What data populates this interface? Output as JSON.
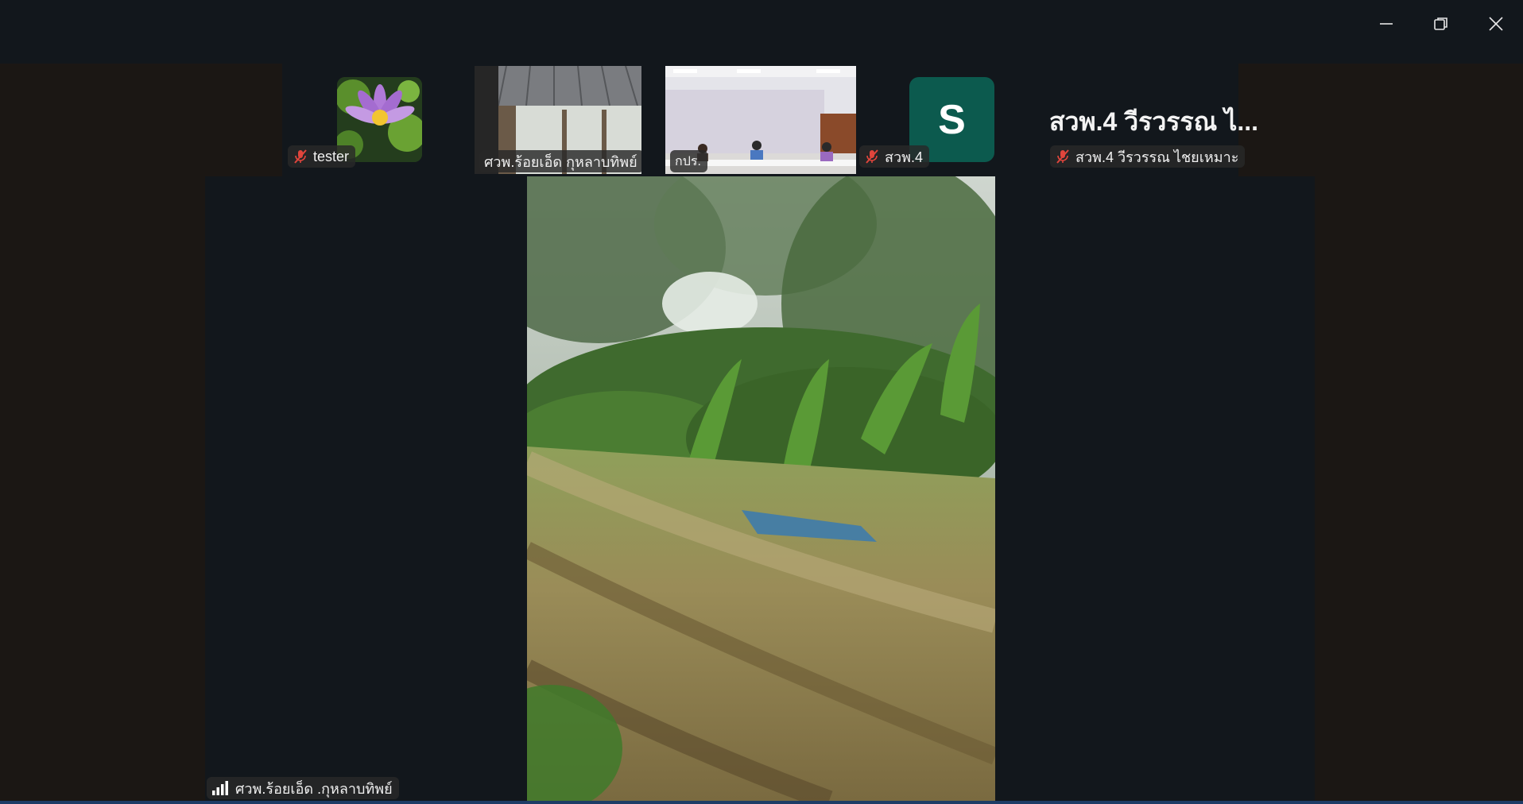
{
  "window": {
    "minimize_icon": "minimize-icon",
    "restore_icon": "restore-icon",
    "close_icon": "close-icon"
  },
  "participants": [
    {
      "name": "tester",
      "muted": true,
      "thumbnail": "lotus-flower-image"
    },
    {
      "name": "ศวพ.ร้อยเอ็ด กุหลาบทิพย์",
      "muted": false,
      "thumbnail": "farm-shed-video"
    },
    {
      "name": "กปร.",
      "muted": false,
      "thumbnail": "meeting-room-video"
    },
    {
      "name": "สวพ.4",
      "muted": true,
      "avatar_letter": "S",
      "avatar_color": "#0c5a4e"
    },
    {
      "name": "สวพ.4 วีรวรรณ ไชยเหมาะ",
      "muted": true,
      "display_title": "สวพ.4 วีรวรรณ ไ..."
    }
  ],
  "active_speaker": {
    "name": "ศวพ.ร้อยเอ็ด .กุหลาบทิพย์",
    "video": "banana-field-video",
    "connection_icon": "signal-bars-icon"
  },
  "colors": {
    "background": "#12171c",
    "muted_icon": "#e0453c",
    "accent_bar": "#1e3c66"
  }
}
